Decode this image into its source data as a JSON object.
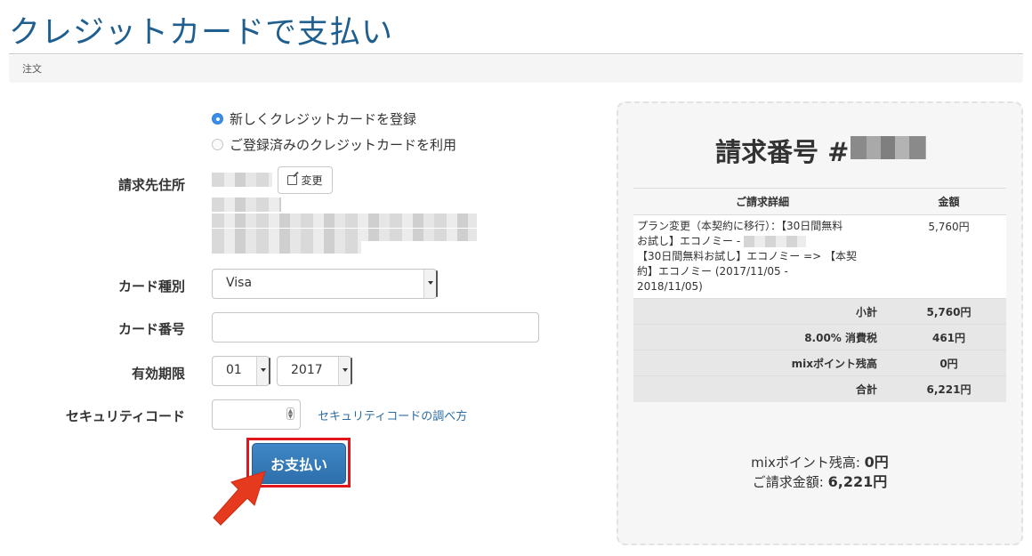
{
  "page": {
    "title": "クレジットカードで支払い",
    "breadcrumb": "注文"
  },
  "card_option": {
    "new_label": "新しくクレジットカードを登録",
    "existing_label": "ご登録済みのクレジットカードを利用",
    "selected": "new"
  },
  "billing": {
    "label": "請求先住所",
    "change_label": "変更"
  },
  "card_type": {
    "label": "カード種別",
    "value": "Visa"
  },
  "card_number": {
    "label": "カード番号",
    "value": ""
  },
  "expiry": {
    "label": "有効期限",
    "month": "01",
    "year": "2017"
  },
  "security_code": {
    "label": "セキュリティコード",
    "value": "",
    "help_link": "セキュリティコードの調べ方"
  },
  "pay_button": "お支払い",
  "invoice": {
    "title": "請求番号 #",
    "header_detail": "ご請求詳細",
    "header_amount": "金額",
    "line_item": {
      "line1": "プラン変更（本契約に移行）：【30日間無料",
      "line2": "お試し】エコノミー -",
      "line3": "【30日間無料お試し】エコノミー => 【本契",
      "line4": "約】エコノミー (2017/11/05 -",
      "line5": "2018/11/05)",
      "amount": "5,760円"
    },
    "subtotal_label": "小計",
    "subtotal": "5,760円",
    "tax_label": "8.00% 消費税",
    "tax": "461円",
    "points_label": "mixポイント残高",
    "points": "0円",
    "total_label": "合計",
    "total": "6,221円"
  },
  "summary": {
    "points_label": "mixポイント残高:",
    "points_value": "0円",
    "billing_label": "ご請求金額:",
    "billing_value": "6,221円"
  },
  "colors": {
    "title": "#1f5f8f",
    "primary_button": "#337ab7",
    "highlight": "#e0161b",
    "link": "#2e6da4"
  }
}
